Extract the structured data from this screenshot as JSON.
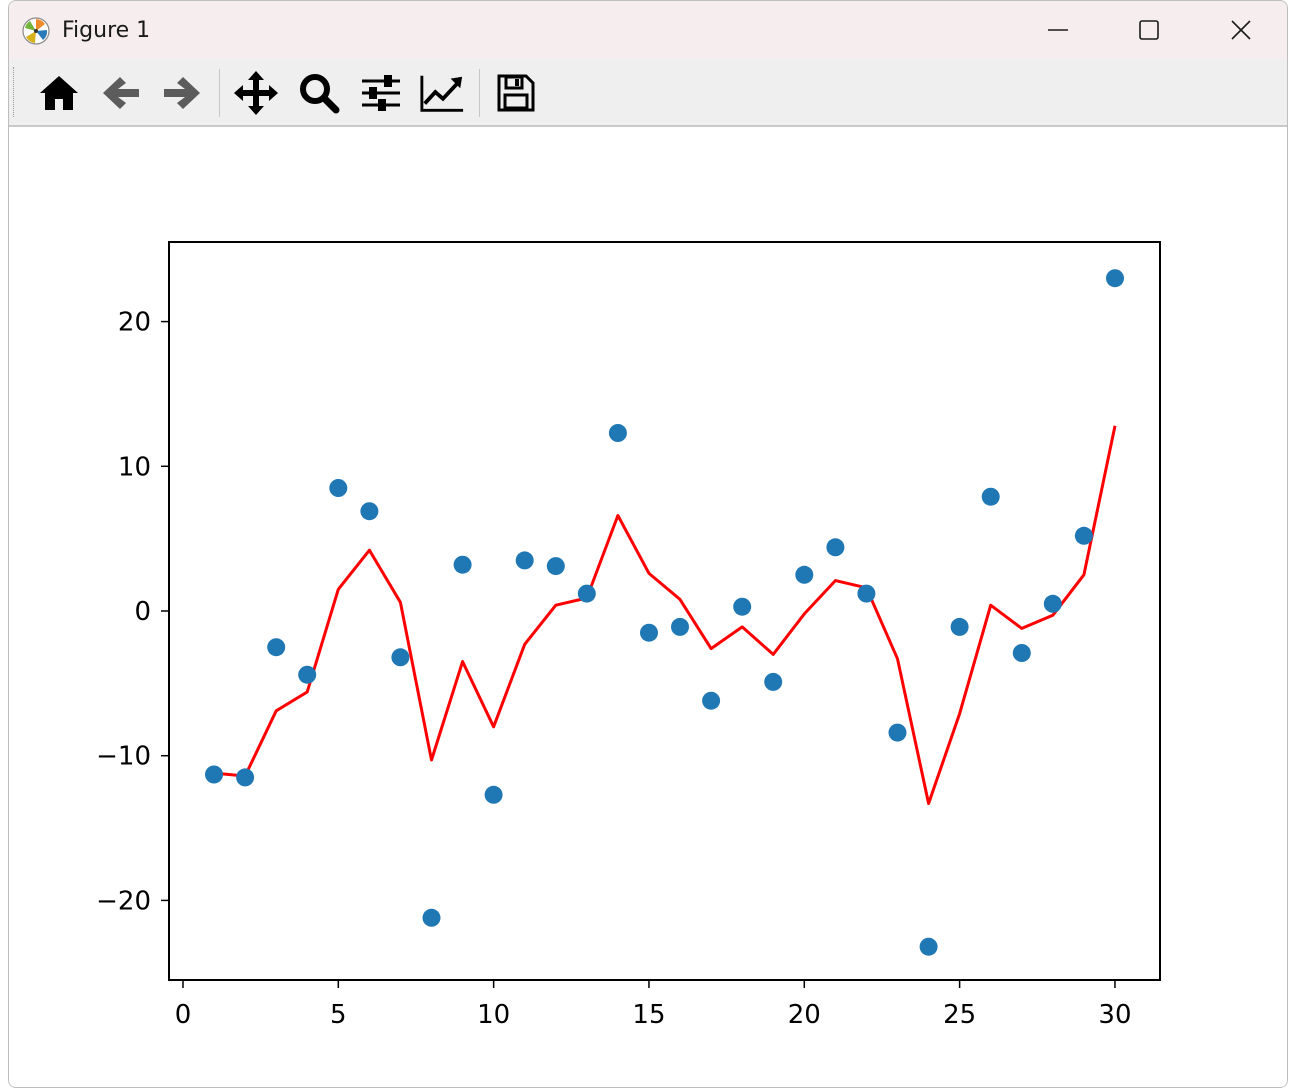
{
  "window": {
    "title": "Figure 1",
    "controls": {
      "minimize": "minimize-icon",
      "maximize": "maximize-icon",
      "close": "close-icon"
    }
  },
  "toolbar": {
    "buttons": [
      {
        "name": "home-button",
        "icon": "home-icon"
      },
      {
        "name": "back-button",
        "icon": "arrow-left-icon"
      },
      {
        "name": "forward-button",
        "icon": "arrow-right-icon"
      },
      {
        "name": "pan-button",
        "icon": "move-icon"
      },
      {
        "name": "zoom-button",
        "icon": "magnifier-icon"
      },
      {
        "name": "subplots-button",
        "icon": "sliders-icon"
      },
      {
        "name": "axes-edit-button",
        "icon": "line-chart-icon"
      },
      {
        "name": "save-button",
        "icon": "floppy-disk-icon"
      }
    ]
  },
  "chart_data": {
    "type": "scatter",
    "title": "",
    "xlabel": "",
    "ylabel": "",
    "xlim": [
      -0.45,
      31.45
    ],
    "ylim": [
      -25.5,
      25.5
    ],
    "xticks": [
      "0",
      "5",
      "10",
      "15",
      "20",
      "25",
      "30"
    ],
    "yticks": [
      "−20",
      "−10",
      "0",
      "10",
      "20"
    ],
    "grid": false,
    "colors": {
      "scatter": "#1f77b4",
      "line": "#ff0000"
    },
    "series": [
      {
        "kind": "scatter",
        "x": [
          1,
          2,
          3,
          4,
          5,
          6,
          7,
          8,
          9,
          10,
          11,
          12,
          13,
          14,
          15,
          16,
          17,
          18,
          19,
          20,
          21,
          22,
          23,
          24,
          25,
          26,
          27,
          28,
          29,
          30
        ],
        "values": [
          -11.3,
          -11.5,
          -2.5,
          -4.4,
          8.5,
          6.9,
          -3.2,
          -21.2,
          3.2,
          -12.7,
          3.5,
          3.1,
          1.2,
          12.3,
          -1.5,
          -1.1,
          -6.2,
          0.3,
          -4.9,
          2.5,
          4.4,
          1.2,
          -8.4,
          -23.2,
          -1.1,
          7.9,
          -2.9,
          0.5,
          5.2,
          23.0
        ]
      },
      {
        "kind": "line",
        "x": [
          1,
          2,
          3,
          4,
          5,
          6,
          7,
          8,
          9,
          10,
          11,
          12,
          13,
          14,
          15,
          16,
          17,
          18,
          19,
          20,
          21,
          22,
          23,
          24,
          25,
          26,
          27,
          28,
          29,
          30
        ],
        "values": [
          -11.2,
          -11.4,
          -6.9,
          -5.6,
          1.5,
          4.2,
          0.6,
          -10.3,
          -3.5,
          -8.0,
          -2.3,
          0.4,
          0.9,
          6.6,
          2.6,
          0.8,
          -2.6,
          -1.1,
          -3.0,
          -0.2,
          2.1,
          1.6,
          -3.3,
          -13.3,
          -7.1,
          0.4,
          -1.2,
          -0.3,
          2.5,
          12.8
        ]
      }
    ]
  }
}
